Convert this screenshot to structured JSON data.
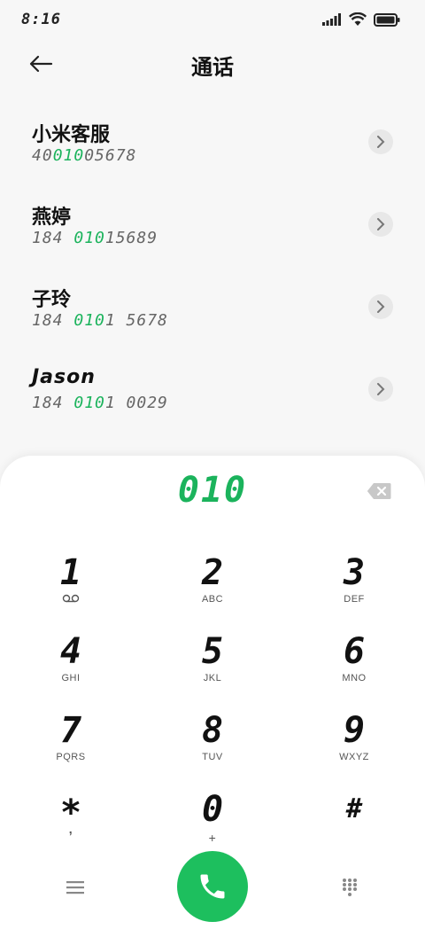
{
  "status_bar": {
    "time": "8:16"
  },
  "header": {
    "title": "通话"
  },
  "contacts": [
    {
      "name": "小米客服",
      "number_pre": "40",
      "number_match": "010",
      "number_post": "05678"
    },
    {
      "name": "燕婷",
      "number_pre": "184 ",
      "number_match": "010",
      "number_post": "15689"
    },
    {
      "name": "子玲",
      "number_pre": "184 ",
      "number_match": "010",
      "number_post": "1 5678"
    },
    {
      "name": "Jason",
      "number_pre": "184 ",
      "number_match": "010",
      "number_post": "1 0029"
    }
  ],
  "dialer": {
    "number": "010",
    "keys": [
      {
        "digit": "1",
        "letters": ""
      },
      {
        "digit": "2",
        "letters": "ABC"
      },
      {
        "digit": "3",
        "letters": "DEF"
      },
      {
        "digit": "4",
        "letters": "GHI"
      },
      {
        "digit": "5",
        "letters": "JKL"
      },
      {
        "digit": "6",
        "letters": "MNO"
      },
      {
        "digit": "7",
        "letters": "PQRS"
      },
      {
        "digit": "8",
        "letters": "TUV"
      },
      {
        "digit": "9",
        "letters": "WXYZ"
      },
      {
        "digit": "*",
        "letters": ","
      },
      {
        "digit": "0",
        "letters": "+"
      },
      {
        "digit": "#",
        "letters": ""
      }
    ]
  },
  "colors": {
    "accent": "#1bb35c",
    "call_button": "#1dbf5e"
  },
  "icons": [
    "signal-icon",
    "wifi-icon",
    "battery-icon",
    "back-arrow-icon",
    "chevron-right-icon",
    "backspace-icon",
    "voicemail-icon",
    "menu-icon",
    "phone-icon",
    "keypad-icon"
  ]
}
